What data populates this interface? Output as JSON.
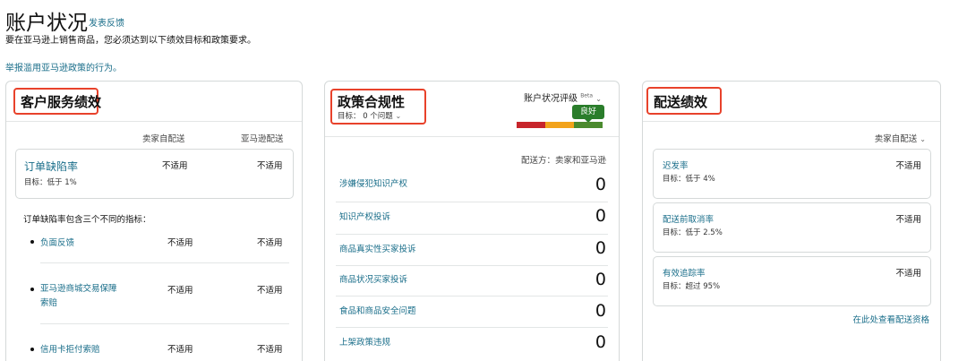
{
  "header": {
    "title": "账户状况",
    "feedback_link": "发表反馈",
    "subtitle": "要在亚马逊上销售商品，您必须达到以下绩效目标和政策要求。",
    "report_link": "举报滥用亚马逊政策的行为。"
  },
  "customer_service": {
    "title": "客户服务绩效",
    "col_seller": "卖家自配送",
    "col_amazon": "亚马逊配送",
    "odr": {
      "label": "订单缺陷率",
      "target": "目标：低于 1%",
      "seller_value": "不适用",
      "amazon_value": "不适用"
    },
    "breakdown_intro": "订单缺陷率包含三个不同的指标：",
    "items": [
      {
        "label": "负面反馈",
        "seller_value": "不适用",
        "amazon_value": "不适用"
      },
      {
        "label": "亚马逊商城交易保障",
        "label_line2": "索赔",
        "seller_value": "不适用",
        "amazon_value": "不适用"
      },
      {
        "label": "信用卡拒付索赔",
        "seller_value": "不适用",
        "amazon_value": "不适用"
      }
    ]
  },
  "policy": {
    "title": "政策合规性",
    "target": "目标： 0 个问题",
    "rating_label": "账户状况评级",
    "rating_beta": "Beta",
    "rating_badge": "良好",
    "gauge_colors": [
      "#c7252b",
      "#f2a31b",
      "#4b8a2e"
    ],
    "ship_by": "配送方：卖家和亚马逊",
    "rows": [
      {
        "label": "涉嫌侵犯知识产权",
        "count": "0"
      },
      {
        "label": "知识产权投诉",
        "count": "0"
      },
      {
        "label": "商品真实性买家投诉",
        "count": "0"
      },
      {
        "label": "商品状况买家投诉",
        "count": "0"
      },
      {
        "label": "食品和商品安全问题",
        "count": "0"
      },
      {
        "label": "上架政策违规",
        "count": "0"
      }
    ]
  },
  "shipping": {
    "title": "配送绩效",
    "filter": "卖家自配送",
    "metrics": [
      {
        "label": "迟发率",
        "target": "目标：低于 4%",
        "value": "不适用"
      },
      {
        "label": "配送前取消率",
        "target": "目标：低于 2.5%",
        "value": "不适用"
      },
      {
        "label": "有效追踪率",
        "target": "目标：超过 95%",
        "value": "不适用"
      }
    ],
    "eligibility_link": "在此处查看配送资格"
  },
  "colors": {
    "link": "#1a6e8a",
    "highlight_red": "#e8422b",
    "badge_green": "#2a7d2b"
  }
}
